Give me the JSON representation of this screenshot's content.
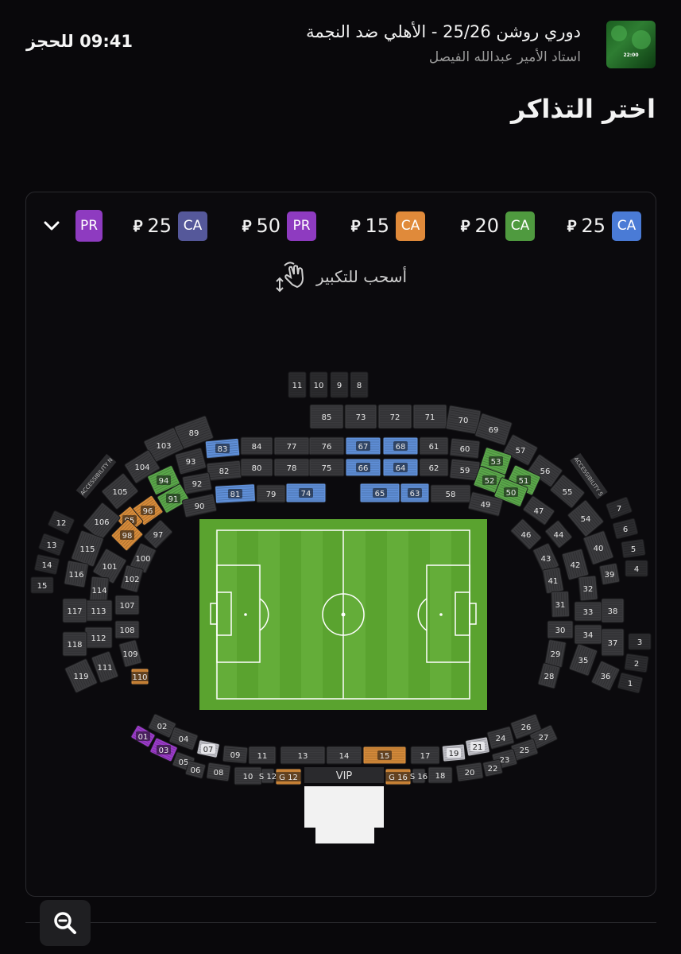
{
  "event": {
    "title": "دوري روشن 25/26 - الأهلي ضد النجمة",
    "venue": "استاد الأمير عبدالله الفيصل",
    "timer": "09:41 للحجز",
    "thumb_text": "22:00"
  },
  "page_title": "اختر التذاكر",
  "legend": [
    {
      "code": "CA",
      "price": "25",
      "color": "#4a7bd6"
    },
    {
      "code": "CA",
      "price": "20",
      "color": "#4f9a3f"
    },
    {
      "code": "CA",
      "price": "15",
      "color": "#e08a3a"
    },
    {
      "code": "PR",
      "price": "50",
      "color": "#8e3bc0"
    },
    {
      "code": "CA",
      "price": "25",
      "color": "#55589a"
    },
    {
      "code": "PR",
      "price": "",
      "color": "#8e3bc0"
    }
  ],
  "hint": "أسحب للتكبير",
  "vip_label": "VIP",
  "sections": {
    "top_row": [
      "11",
      "10",
      "9",
      "8"
    ],
    "north": [
      "85",
      "73",
      "72",
      "71",
      "70",
      "69",
      "89",
      "103",
      "83",
      "84",
      "77",
      "76",
      "67",
      "68",
      "61",
      "60",
      "57",
      "104",
      "93",
      "82",
      "80",
      "78",
      "75",
      "66",
      "64",
      "62",
      "59",
      "53",
      "56",
      "105",
      "94",
      "92",
      "81",
      "79",
      "74",
      "65",
      "63",
      "58",
      "52",
      "51",
      "55",
      "91",
      "90",
      "49",
      "50",
      "47",
      "54",
      "96",
      "95",
      "97",
      "46",
      "44",
      "40",
      "98",
      "100",
      "43",
      "42",
      "39",
      "101",
      "102",
      "41",
      "32",
      "31",
      "33",
      "34",
      "30",
      "29",
      "35",
      "36",
      "28",
      "106",
      "115",
      "116",
      "114",
      "107",
      "113",
      "117",
      "112",
      "108",
      "118",
      "109",
      "111",
      "119",
      "110",
      "37",
      "38"
    ],
    "outer_west": [
      "12",
      "13",
      "14",
      "15"
    ],
    "outer_east": [
      "7",
      "6",
      "5",
      "4",
      "3",
      "2",
      "1"
    ],
    "south": [
      "02",
      "01",
      "04",
      "03",
      "05",
      "06",
      "07",
      "08",
      "09",
      "11",
      "10",
      "13",
      "14",
      "15",
      "17",
      "19",
      "21",
      "24",
      "26",
      "27",
      "25",
      "23",
      "22",
      "20",
      "18"
    ],
    "gates": [
      "G 12",
      "G 16",
      "S 12",
      "S 16"
    ],
    "accessibility": [
      "ACCESSIBILITY N",
      "ACCESSIBILITY S"
    ]
  }
}
